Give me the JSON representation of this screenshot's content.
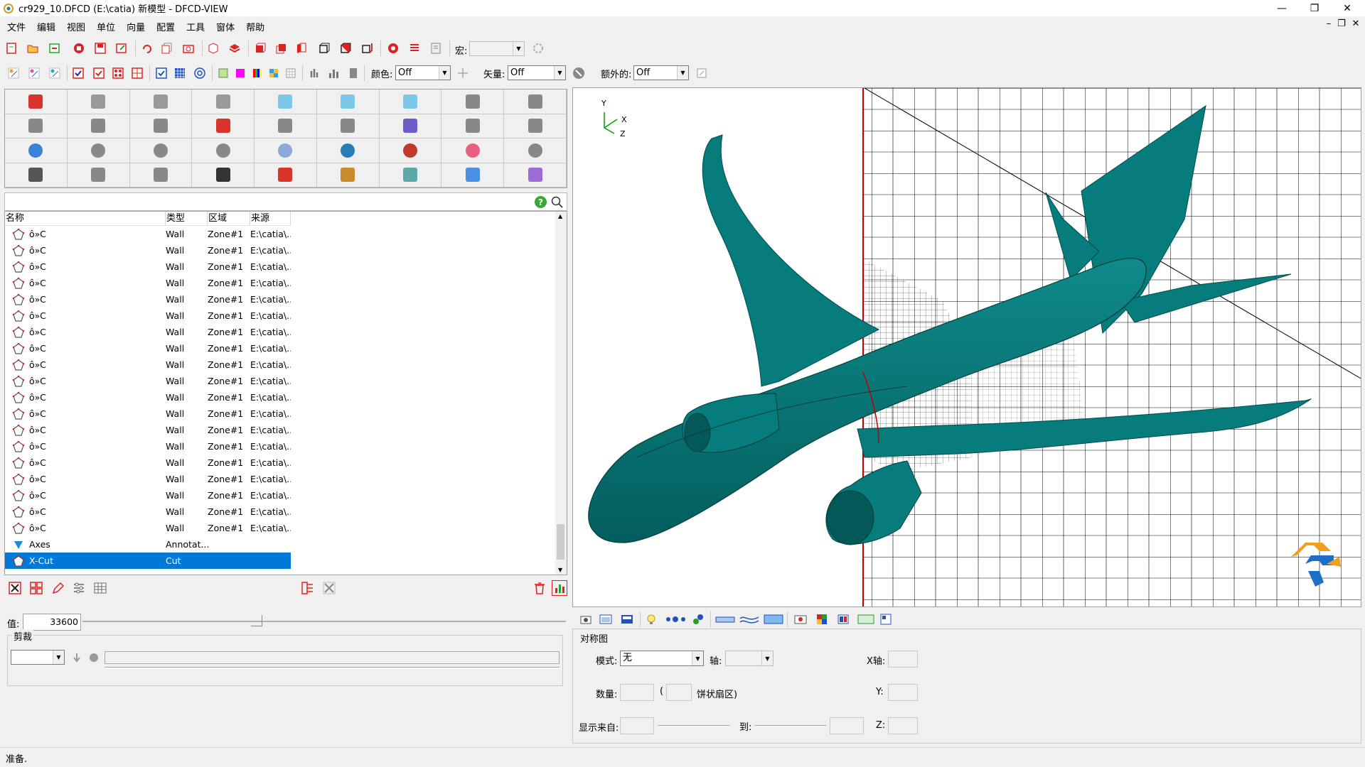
{
  "window": {
    "title": "cr929_10.DFCD (E:\\catia) 新模型 - DFCD-VIEW",
    "minimize": "—",
    "maximize": "❐",
    "close": "✕"
  },
  "menu": [
    "文件",
    "编辑",
    "视图",
    "单位",
    "向量",
    "配置",
    "工具",
    "窗体",
    "帮助"
  ],
  "mdi_controls": [
    "–",
    "❐",
    "✕"
  ],
  "toolbar1": {
    "macro_label": "宏:",
    "macro_value": ""
  },
  "toolbar2": {
    "color_label": "颜色:",
    "color_value": "Off",
    "vector_label": "矢量:",
    "vector_value": "Off",
    "extra_label": "额外的:",
    "extra_value": "Off"
  },
  "tool_grid_icons": [
    "iso-icon",
    "pillar-icon",
    "curve-icon",
    "boot-icon",
    "cube-icon",
    "cube-icon",
    "cube-icon",
    "box-icon",
    "box-icon",
    "shape-icon",
    "hexagon-icon",
    "hexagon-icon",
    "target-icon",
    "wave-icon",
    "map-icon",
    "gear-icon",
    "book-icon",
    "graph-icon",
    "globe-icon",
    "chart-icon",
    "page-icon",
    "stack-icon",
    "panel-icon",
    "palette-icon",
    "sphere-icon",
    "clipboard-icon",
    "bar-icon",
    "clock-icon",
    "cube-icon",
    "cube-icon",
    "briefcase-icon",
    "photo-icon",
    "package-icon",
    "disc-icon",
    "ruler-icon",
    "edit-icon"
  ],
  "list": {
    "columns": [
      "名称",
      "类型",
      "区域",
      "来源"
    ],
    "rows": [
      {
        "name": "ô»C",
        "type": "Wall",
        "zone": "Zone#1",
        "source": "E:\\catia\\..."
      },
      {
        "name": "ô»C",
        "type": "Wall",
        "zone": "Zone#1",
        "source": "E:\\catia\\..."
      },
      {
        "name": "ô»C",
        "type": "Wall",
        "zone": "Zone#1",
        "source": "E:\\catia\\..."
      },
      {
        "name": "ô»C",
        "type": "Wall",
        "zone": "Zone#1",
        "source": "E:\\catia\\..."
      },
      {
        "name": "ô»C",
        "type": "Wall",
        "zone": "Zone#1",
        "source": "E:\\catia\\..."
      },
      {
        "name": "ô»C",
        "type": "Wall",
        "zone": "Zone#1",
        "source": "E:\\catia\\..."
      },
      {
        "name": "ô»C",
        "type": "Wall",
        "zone": "Zone#1",
        "source": "E:\\catia\\..."
      },
      {
        "name": "ô»C",
        "type": "Wall",
        "zone": "Zone#1",
        "source": "E:\\catia\\..."
      },
      {
        "name": "ô»C",
        "type": "Wall",
        "zone": "Zone#1",
        "source": "E:\\catia\\..."
      },
      {
        "name": "ô»C",
        "type": "Wall",
        "zone": "Zone#1",
        "source": "E:\\catia\\..."
      },
      {
        "name": "ô»C",
        "type": "Wall",
        "zone": "Zone#1",
        "source": "E:\\catia\\..."
      },
      {
        "name": "ô»C",
        "type": "Wall",
        "zone": "Zone#1",
        "source": "E:\\catia\\..."
      },
      {
        "name": "ô»C",
        "type": "Wall",
        "zone": "Zone#1",
        "source": "E:\\catia\\..."
      },
      {
        "name": "ô»C",
        "type": "Wall",
        "zone": "Zone#1",
        "source": "E:\\catia\\..."
      },
      {
        "name": "ô»C",
        "type": "Wall",
        "zone": "Zone#1",
        "source": "E:\\catia\\..."
      },
      {
        "name": "ô»C",
        "type": "Wall",
        "zone": "Zone#1",
        "source": "E:\\catia\\..."
      },
      {
        "name": "ô»C",
        "type": "Wall",
        "zone": "Zone#1",
        "source": "E:\\catia\\..."
      },
      {
        "name": "ô»C",
        "type": "Wall",
        "zone": "Zone#1",
        "source": "E:\\catia\\..."
      },
      {
        "name": "ô»C",
        "type": "Wall",
        "zone": "Zone#1",
        "source": "E:\\catia\\..."
      },
      {
        "name": "Axes",
        "type": "Annotat...",
        "zone": "",
        "source": ""
      },
      {
        "name": "X-Cut",
        "type": "Cut",
        "zone": "",
        "source": "",
        "selected": true
      }
    ]
  },
  "value_row": {
    "label": "值:",
    "value": "33600",
    "slider_fraction": 0.36
  },
  "clip": {
    "label": "剪裁",
    "mode_value": ""
  },
  "viewport": {
    "axis_x": "X",
    "axis_y": "Y",
    "axis_z": "Z",
    "model_color": "#037a7a",
    "cut_plane_color": "#c00000"
  },
  "symmetry": {
    "title": "对称图",
    "mode_label": "模式:",
    "mode_value": "无",
    "axis_label": "轴:",
    "axis_value": "",
    "x_axis_label": "X轴:",
    "count_label": "数量:",
    "paren_open": "(",
    "sector_label": "饼状扇区)",
    "y_label": "Y:",
    "show_from_label": "显示来自:",
    "to_label": "到:",
    "z_label": "Z:"
  },
  "status": {
    "text": "准备."
  }
}
